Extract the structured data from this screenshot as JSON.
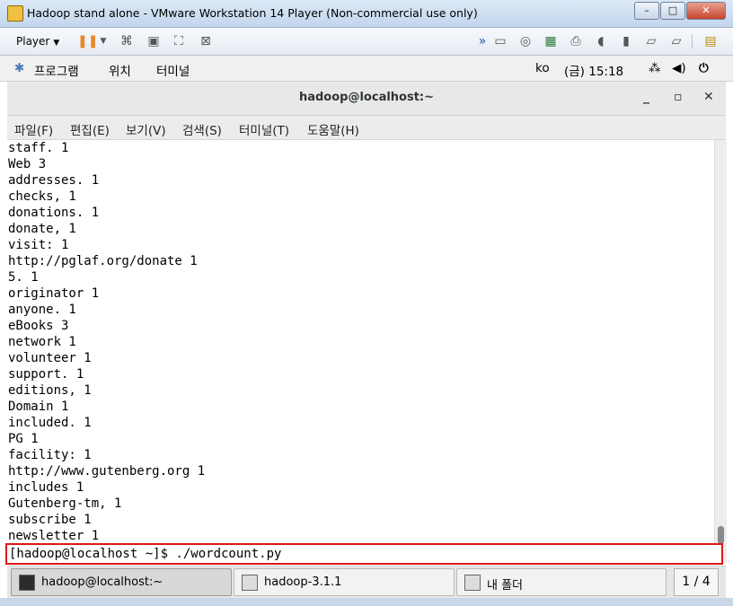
{
  "vm_window": {
    "title": "Hadoop stand alone - VMware Workstation 14 Player (Non-commercial use only)",
    "controls": {
      "minimize": "–",
      "maximize": "□",
      "close": "✕"
    }
  },
  "vm_toolbar": {
    "player_label": "Player"
  },
  "gnome_bar": {
    "applications": "프로그램",
    "places": "위치",
    "terminal": "터미널",
    "lang": "ko",
    "clock": "(금) 15:18"
  },
  "terminal": {
    "title": "hadoop@localhost:~",
    "controls": {
      "minimize": "_",
      "maximize": "▫",
      "close": "✕"
    },
    "menu": [
      "파일(F)",
      "편집(E)",
      "보기(V)",
      "검색(S)",
      "터미널(T)",
      "도움말(H)"
    ],
    "lines": [
      "staff. 1",
      "Web 3",
      "addresses. 1",
      "checks, 1",
      "donations. 1",
      "donate, 1",
      "visit: 1",
      "http://pglaf.org/donate 1",
      "5. 1",
      "originator 1",
      "anyone. 1",
      "eBooks 3",
      "network 1",
      "volunteer 1",
      "support. 1",
      "editions, 1",
      "Domain 1",
      "included. 1",
      "PG 1",
      "facility: 1",
      "http://www.gutenberg.org 1",
      "includes 1",
      "Gutenberg-tm, 1",
      "subscribe 1",
      "newsletter 1"
    ],
    "prompt": "[hadoop@localhost ~]$ ./wordcount.py"
  },
  "taskbar": {
    "tasks": [
      "hadoop@localhost:~",
      "hadoop-3.1.1",
      "내 폴더"
    ],
    "pager": "1 / 4"
  },
  "colors": {
    "highlight_border": "#e01818",
    "pause_accent": "#e8892a"
  }
}
